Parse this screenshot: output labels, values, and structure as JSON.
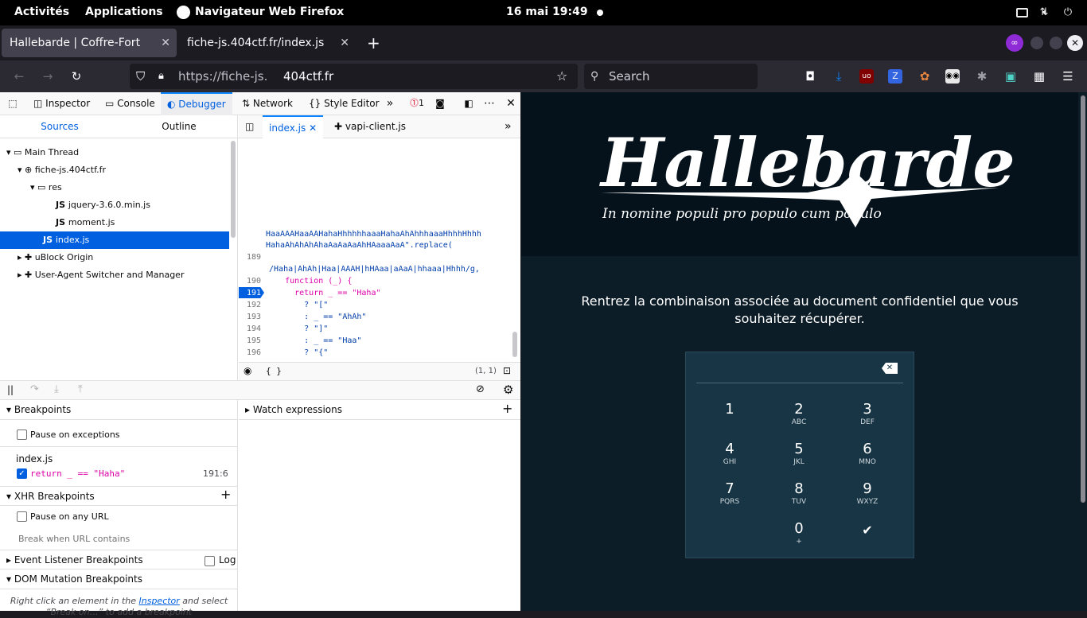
{
  "topbar": {
    "activities": "Activités",
    "applications": "Applications",
    "app_name": "Navigateur Web Firefox",
    "clock": "16 mai  19:49"
  },
  "tabs": [
    {
      "title": "Hallebarde | Coffre-Fort",
      "active": true
    },
    {
      "title": "fiche-js.404ctf.fr/index.js",
      "active": false
    }
  ],
  "navbar": {
    "url_prefix": "https://fiche-js.",
    "url_domain": "404ctf.fr",
    "search_placeholder": "Search"
  },
  "devtools": {
    "tabs": [
      "Inspector",
      "Console",
      "Debugger",
      "Network",
      "Style Editor"
    ],
    "selected_tab": "Debugger",
    "error_count": "1",
    "source_tabs": [
      "Sources",
      "Outline"
    ],
    "tree": [
      {
        "label": "Main Thread",
        "icon": "thread"
      },
      {
        "label": "fiche-js.404ctf.fr",
        "icon": "globe"
      },
      {
        "label": "res",
        "icon": "folder"
      },
      {
        "label": "jquery-3.6.0.min.js",
        "icon": "js"
      },
      {
        "label": "moment.js",
        "icon": "js"
      },
      {
        "label": "index.js",
        "icon": "js",
        "selected": true
      },
      {
        "label": "uBlock Origin",
        "icon": "extension"
      },
      {
        "label": "User-Agent Switcher and Manager",
        "icon": "extension"
      }
    ],
    "editor_tabs": [
      "index.js",
      "vapi-client.js"
    ],
    "code_lines": [
      {
        "num": "",
        "text": "HaaAAAHaaAAHahaHhhhhhaaaHahaAhAhhhaaaHhhhHhhh"
      },
      {
        "num": "",
        "text": "HahaAhAhAhAhaAaAaAaAhHAaaaAaA\".replace("
      },
      {
        "num": "189",
        "text": ""
      },
      {
        "num": "",
        "text": " /Haha|AhAh|Haa|AAAH|hHAaa|aAaA|hhaaa|Hhhh/g,"
      },
      {
        "num": "190",
        "text": "    function (_) {"
      },
      {
        "num": "191",
        "text": "      return _ == \"Haha\""
      },
      {
        "num": "192",
        "text": "        ? \"[\""
      },
      {
        "num": "193",
        "text": "        : _ == \"AhAh\""
      },
      {
        "num": "194",
        "text": "        ? \"]\""
      },
      {
        "num": "195",
        "text": "        : _ == \"Haa\""
      },
      {
        "num": "196",
        "text": "        ? \"{\""
      }
    ],
    "cursor_pos": "(1, 1)",
    "pretty_print": "{ }",
    "sections": {
      "breakpoints": "Breakpoints",
      "pause_exceptions": "Pause on exceptions",
      "bp_file": "index.js",
      "bp_code": "return _ == \"Haha\"",
      "bp_location": "191:6",
      "xhr": "XHR Breakpoints",
      "pause_any_url": "Pause on any URL",
      "break_url_placeholder": "Break when URL contains",
      "event_listener": "Event Listener Breakpoints",
      "log": "Log",
      "dom_mutation": "DOM Mutation Breakpoints",
      "dom_hint_1": "Right click an element in the ",
      "dom_hint_link": "Inspector",
      "dom_hint_2": " and select",
      "dom_hint_3": "“Break on…” to add a breakpoint",
      "watch": "Watch expressions"
    }
  },
  "page": {
    "brand_title": "Hallebarde",
    "brand_motto": "In nomine populi pro populo cum populo",
    "prompt": "Rentrez la combinaison associée au document confidentiel que vous souhaitez récupérer.",
    "keys": [
      {
        "d": "1",
        "l": ""
      },
      {
        "d": "2",
        "l": "ABC"
      },
      {
        "d": "3",
        "l": "DEF"
      },
      {
        "d": "4",
        "l": "GHI"
      },
      {
        "d": "5",
        "l": "JKL"
      },
      {
        "d": "6",
        "l": "MNO"
      },
      {
        "d": "7",
        "l": "PQRS"
      },
      {
        "d": "8",
        "l": "TUV"
      },
      {
        "d": "9",
        "l": "WXYZ"
      },
      {
        "d": "0",
        "l": "+"
      }
    ],
    "confirm_glyph": "✔",
    "backspace_glyph": "⌫"
  },
  "colors": {
    "page_bg": "#0d1d28",
    "keypad_bg": "#183545",
    "devtools_accent": "#0060df"
  }
}
